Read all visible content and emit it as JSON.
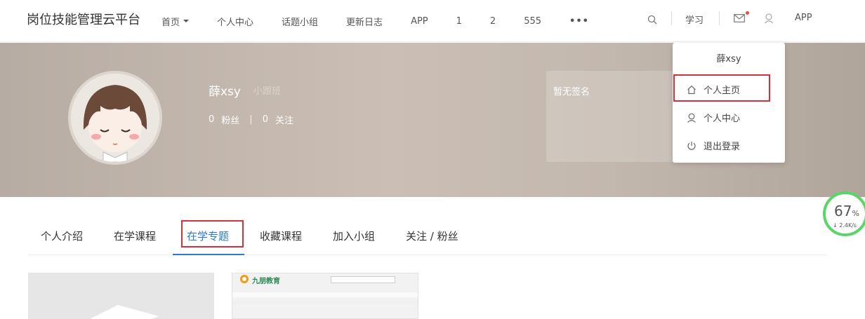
{
  "brand": "岗位技能管理云平台",
  "nav": {
    "items": [
      "首页",
      "个人中心",
      "话题小组",
      "更新日志",
      "APP",
      "1",
      "2",
      "555"
    ],
    "more": "•••"
  },
  "tools": {
    "study": "学习",
    "app": "APP"
  },
  "profile": {
    "username": "薛xsy",
    "level": "小跟班",
    "fans_count": "0",
    "fans_label": "粉丝",
    "follow_count": "0",
    "follow_label": "关注",
    "separator": "|",
    "signature": "暂无签名"
  },
  "dropdown": {
    "name": "薛xsy",
    "items": [
      "个人主页",
      "个人中心",
      "退出登录"
    ]
  },
  "tabs": [
    "个人介绍",
    "在学课程",
    "在学专题",
    "收藏课程",
    "加入小组",
    "关注 / 粉丝"
  ],
  "active_tab": "在学专题",
  "card2": {
    "logo": "九朋教育"
  },
  "speed": {
    "percent": "67",
    "unit": "%",
    "rate": "↓ 2.4K/s"
  },
  "colors": {
    "accent": "#2b7bc5",
    "highlight_box": "#d8303a",
    "speed_ring": "#5bd46a"
  }
}
